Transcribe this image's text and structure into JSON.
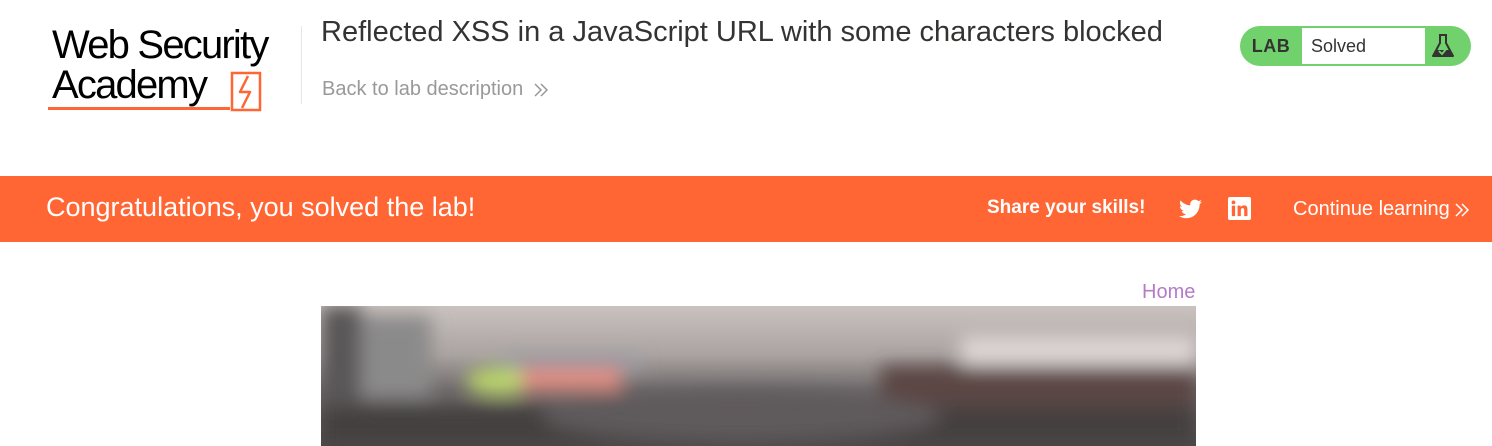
{
  "header": {
    "logo_line1": "Web Security",
    "logo_line2": "Academy",
    "lab_title": "Reflected XSS in a JavaScript URL with some characters blocked",
    "back_link": "Back to lab description"
  },
  "lab_status": {
    "label": "LAB",
    "state": "Solved",
    "icon": "flask-icon"
  },
  "banner": {
    "message": "Congratulations, you solved the lab!",
    "share_label": "Share your skills!",
    "share_icons": [
      "twitter-icon",
      "linkedin-icon"
    ],
    "continue_label": "Continue learning"
  },
  "nav": {
    "home": "Home"
  },
  "colors": {
    "banner": "#ff6633",
    "lab_badge": "#70d16d",
    "link_purple": "#b57bc9",
    "logo_accent": "#ff6633"
  }
}
